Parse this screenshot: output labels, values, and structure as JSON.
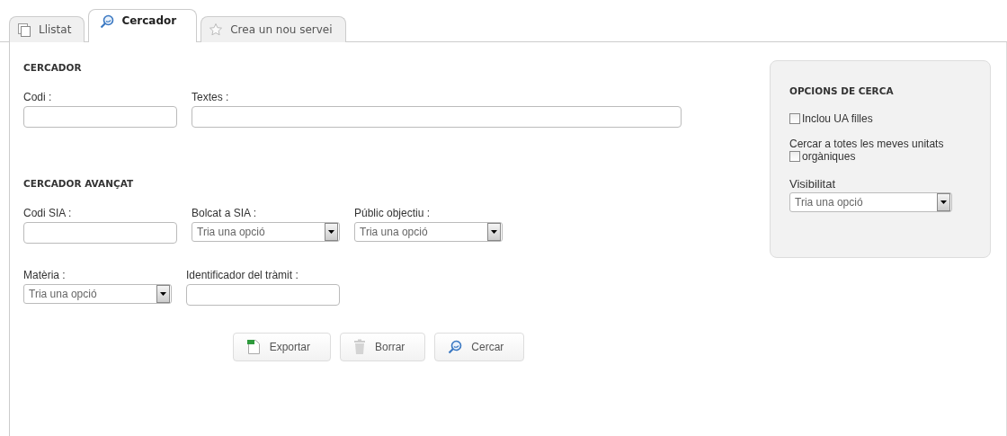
{
  "tabs": [
    {
      "label": "Llistat",
      "selected": false
    },
    {
      "label": "Cercador",
      "selected": true
    },
    {
      "label": "Crea un nou servei",
      "selected": false
    }
  ],
  "search": {
    "title": "CERCADOR",
    "rows": [
      [
        {
          "label": "Codi :",
          "kind": "text"
        },
        {
          "label": "Textes :",
          "kind": "text"
        }
      ]
    ]
  },
  "advanced": {
    "title": "CERCADOR AVANÇAT",
    "rows": [
      [
        {
          "label": "Codi SIA :",
          "kind": "text"
        },
        {
          "label": "Bolcat a SIA :",
          "kind": "select",
          "placeholder": "Tria una opció"
        },
        {
          "label": "Públic objectiu :",
          "kind": "select",
          "placeholder": "Tria una opció"
        }
      ],
      [
        {
          "label": "Matèria :",
          "kind": "select",
          "placeholder": "Tria una opció"
        },
        {
          "label": "Identificador del tràmit :",
          "kind": "text"
        }
      ]
    ]
  },
  "buttons": [
    {
      "label": "Exportar"
    },
    {
      "label": "Borrar"
    },
    {
      "label": "Cercar"
    }
  ],
  "options": {
    "title": "OPCIONS DE CERCA",
    "include_children": {
      "label": "Inclou UA filles",
      "checked": false
    },
    "all_units": {
      "text": "Cercar a totes les meves unitats",
      "label": "orgàniques",
      "checked": false
    },
    "visibility": {
      "label": "Visibilitat",
      "placeholder": "Tria una opció"
    }
  }
}
